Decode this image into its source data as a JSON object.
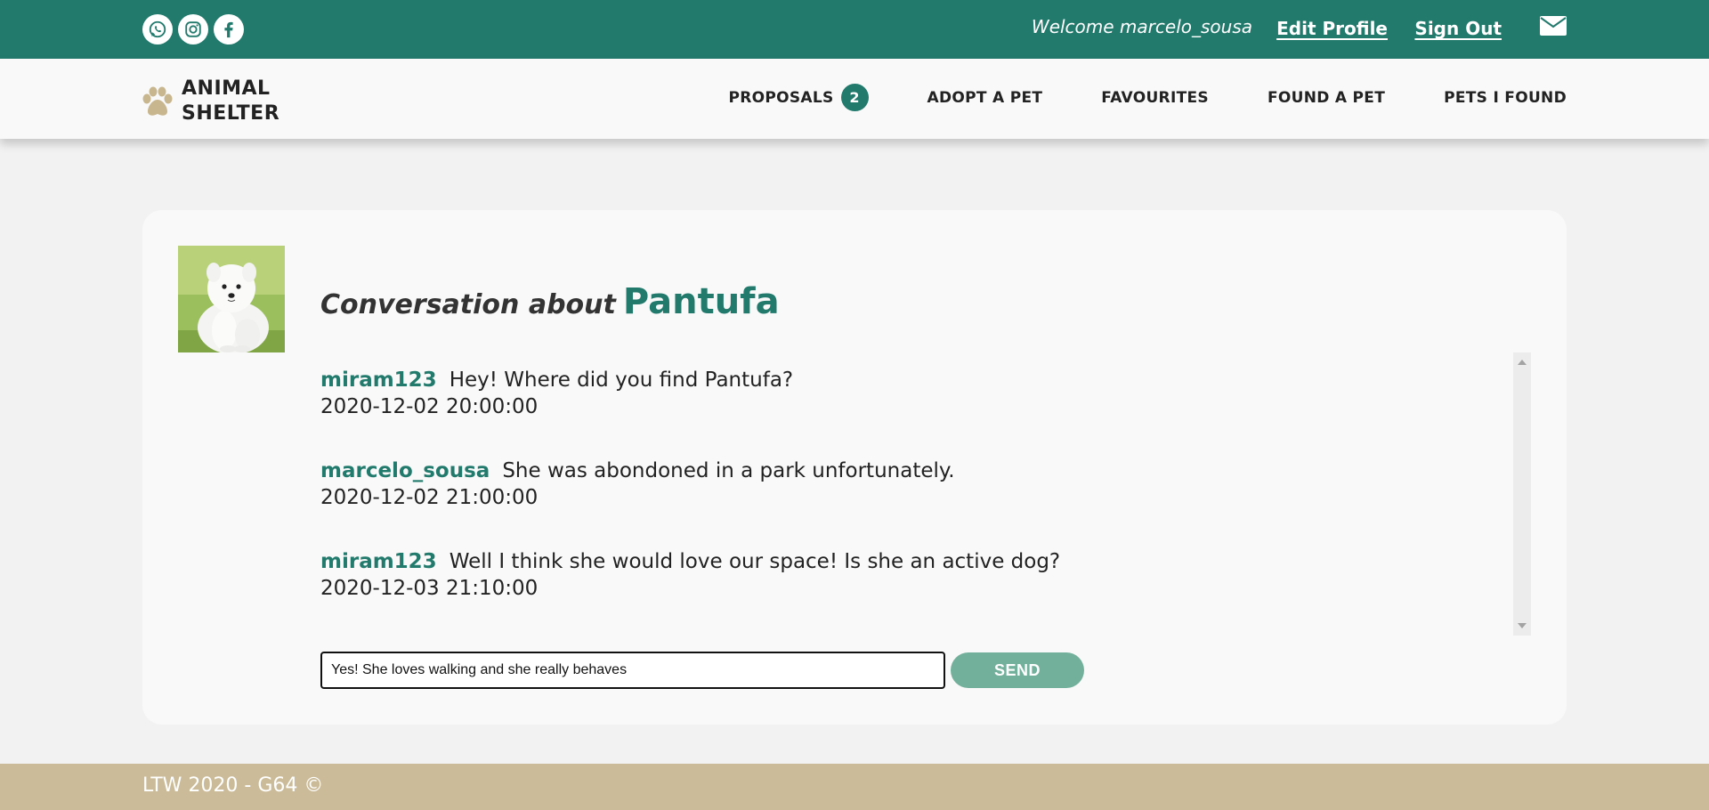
{
  "header": {
    "social_icons": [
      "whatsapp-icon",
      "instagram-icon",
      "facebook-icon"
    ],
    "welcome_text": "Welcome marcelo_sousa",
    "edit_profile_label": "Edit Profile",
    "sign_out_label": "Sign Out",
    "mail_icon": "mail-icon"
  },
  "nav": {
    "logo_icon": "paw-icon",
    "logo_line1": "ANIMAL",
    "logo_line2": "SHELTER",
    "items": [
      {
        "label": "PROPOSALS",
        "badge": "2"
      },
      {
        "label": "ADOPT A PET"
      },
      {
        "label": "FAVOURITES"
      },
      {
        "label": "FOUND A PET"
      },
      {
        "label": "PETS I FOUND"
      }
    ]
  },
  "conversation": {
    "title_prefix": "Conversation about",
    "pet_name": "Pantufa",
    "messages": [
      {
        "user": "miram123",
        "text": "Hey! Where did you find Pantufa?",
        "time": "2020-12-02 20:00:00"
      },
      {
        "user": "marcelo_sousa",
        "text": "She was abondoned in a park unfortunately.",
        "time": "2020-12-02 21:00:00"
      },
      {
        "user": "miram123",
        "text": "Well I think she would love our space! Is she an active dog?",
        "time": "2020-12-03 21:10:00"
      }
    ],
    "reply_value": "Yes! She loves walking and she really behaves",
    "send_label": "SEND"
  },
  "colors": {
    "brand_green": "#227a6d",
    "send_button": "#72b09b",
    "footer": "#cbbb98",
    "paw": "#c8b68e"
  },
  "footer": {
    "text": "LTW 2020 - G64 ©"
  }
}
